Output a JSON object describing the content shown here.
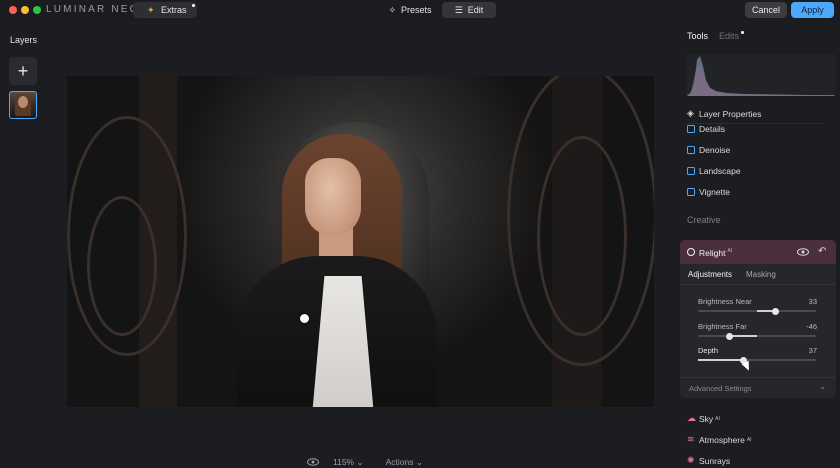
{
  "app": {
    "logo_text": "LUMINAR NEO"
  },
  "topbar": {
    "extras_label": "Extras",
    "presets_label": "Presets",
    "edit_label": "Edit",
    "cancel_label": "Cancel",
    "apply_label": "Apply"
  },
  "layers": {
    "title": "Layers",
    "add_symbol": "+"
  },
  "bottom": {
    "zoom": "115%",
    "actions": "Actions"
  },
  "panel": {
    "tools_tab": "Tools",
    "edits_tab": "Edits",
    "items": [
      "Layer Properties",
      "Details",
      "Denoise",
      "Landscape",
      "Vignette"
    ],
    "section_creative": "Creative",
    "relight": {
      "title": "Relight",
      "badge": "AI",
      "tabs": [
        "Adjustments",
        "Masking"
      ],
      "sliders": [
        {
          "label": "Brightness Near",
          "value": "33",
          "norm": 0.66
        },
        {
          "label": "Brightness Far",
          "value": "-46",
          "norm": 0.27
        },
        {
          "label": "Depth",
          "value": "37",
          "norm": 0.385
        }
      ],
      "advanced_label": "Advanced Settings"
    },
    "extra_items": [
      {
        "label": "Sky",
        "badge": "AI",
        "icon": "cloud-icon"
      },
      {
        "label": "Atmosphere",
        "badge": "AI",
        "icon": "atmosphere-icon"
      },
      {
        "label": "Sunrays",
        "badge": "",
        "icon": "sun-icon"
      }
    ]
  },
  "colors": {
    "accent": "#4aa8ff",
    "relight_header": "#4b2f3c",
    "ai_badge": "#f1a0bf"
  }
}
